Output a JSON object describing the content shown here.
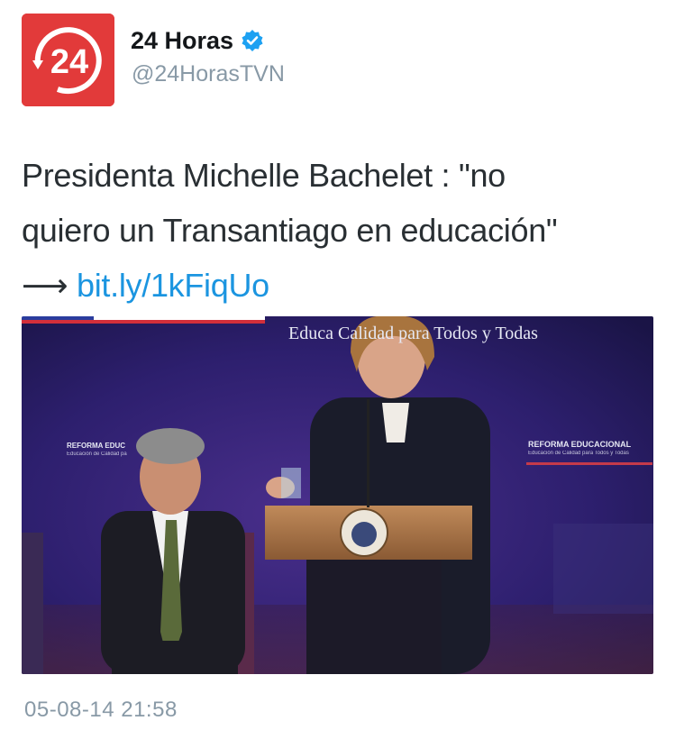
{
  "account": {
    "avatar_text": "24",
    "display_name": "24 Horas",
    "handle": "@24HorasTVN",
    "verified": true,
    "brand_color": "#e23a3a"
  },
  "tweet": {
    "line1": "Presidenta Michelle Bachelet : \"no",
    "line2": "quiero un Transantiago en educación\"",
    "arrow": "⟶",
    "link": "bit.ly/1kFiqUo",
    "link_color": "#1b95e0"
  },
  "photo": {
    "backdrop_title": "Educa        Calidad para Todos y Todas",
    "sign_left_title": "REFORMA EDUC",
    "sign_left_sub": "Educación de Calidad pa",
    "sign_right_title": "REFORMA EDUCACIONAL",
    "sign_right_sub": "Educación de Calidad para Todos y Todas"
  },
  "timestamp": "05-08-14 21:58"
}
